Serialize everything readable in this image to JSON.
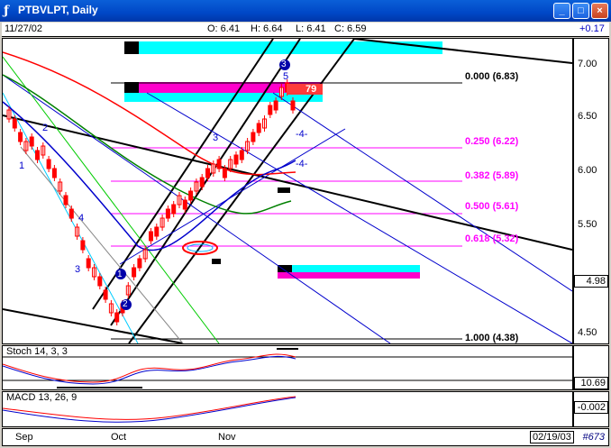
{
  "window": {
    "title": "PTBVLPT, Daily",
    "minimize": "_",
    "maximize": "□",
    "close": "×"
  },
  "header": {
    "date": "11/27/02",
    "open": "O: 6.41",
    "high": "H: 6.64",
    "low": "L: 6.41",
    "close": "C: 6.59",
    "change": "+0.17"
  },
  "price_axis": {
    "ticks": [
      "7.00",
      "6.50",
      "6.00",
      "5.50",
      "4.98",
      "4.50"
    ],
    "current_price": "4.98"
  },
  "fib_levels": [
    {
      "label": "0.000 (6.83)",
      "color": "#000000"
    },
    {
      "label": "0.250 (6.22)",
      "color": "#ff00ff"
    },
    {
      "label": "0.382 (5.89)",
      "color": "#ff00ff"
    },
    {
      "label": "0.500 (5.61)",
      "color": "#ff00ff"
    },
    {
      "label": "0.618 (5.32)",
      "color": "#ff00ff"
    },
    {
      "label": "1.000 (4.38)",
      "color": "#000000"
    }
  ],
  "annotations": {
    "flag_value": "79",
    "wave_labels": [
      "1",
      "2",
      "3",
      "4",
      "5",
      "-4-",
      "-4-",
      "3",
      "4",
      "2",
      "1"
    ]
  },
  "stoch": {
    "label": "Stoch 14, 3, 3",
    "value": "10.69"
  },
  "macd": {
    "label": "MACD 13, 26, 9",
    "value": "-0.002"
  },
  "time_axis": {
    "months": [
      "Sep",
      "Oct",
      "Nov"
    ],
    "date": "02/19/03",
    "count": "#673"
  },
  "colors": {
    "fib": "#ff00ff",
    "cyan_band": "#00ffff",
    "magenta_band": "#ff00cc",
    "up": "#ff0000",
    "down": "#ff0000"
  }
}
